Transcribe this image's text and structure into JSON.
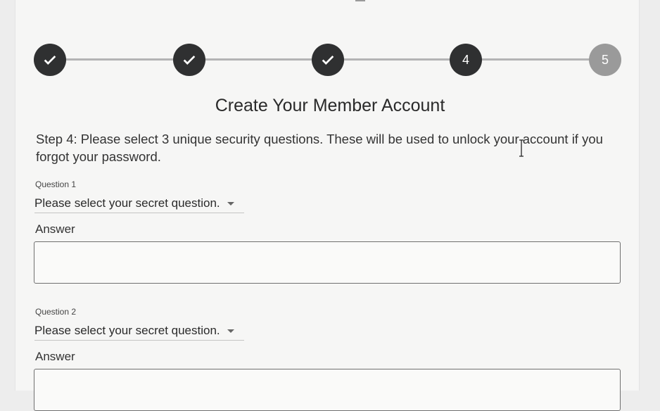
{
  "stepper": {
    "steps": [
      {
        "number": "1",
        "state": "complete",
        "icon": "check-icon"
      },
      {
        "number": "2",
        "state": "complete",
        "icon": "check-icon"
      },
      {
        "number": "3",
        "state": "complete",
        "icon": "check-icon"
      },
      {
        "number": "4",
        "state": "active"
      },
      {
        "number": "5",
        "state": "pending"
      }
    ]
  },
  "form": {
    "title": "Create Your Member Account",
    "instructions": "Step 4: Please select 3 unique security questions. These will be used to unlock your account if you forgot your password.",
    "questions": [
      {
        "label": "Question 1",
        "select_value": "Please select your secret question.",
        "answer_label": "Answer",
        "answer_value": ""
      },
      {
        "label": "Question 2",
        "select_value": "Please select your secret question.",
        "answer_label": "Answer",
        "answer_value": ""
      }
    ]
  },
  "colors": {
    "step_complete": "#2f3031",
    "step_pending": "#9a9a9a",
    "line": "#b4b4b4",
    "card": "#f6f6f5"
  }
}
